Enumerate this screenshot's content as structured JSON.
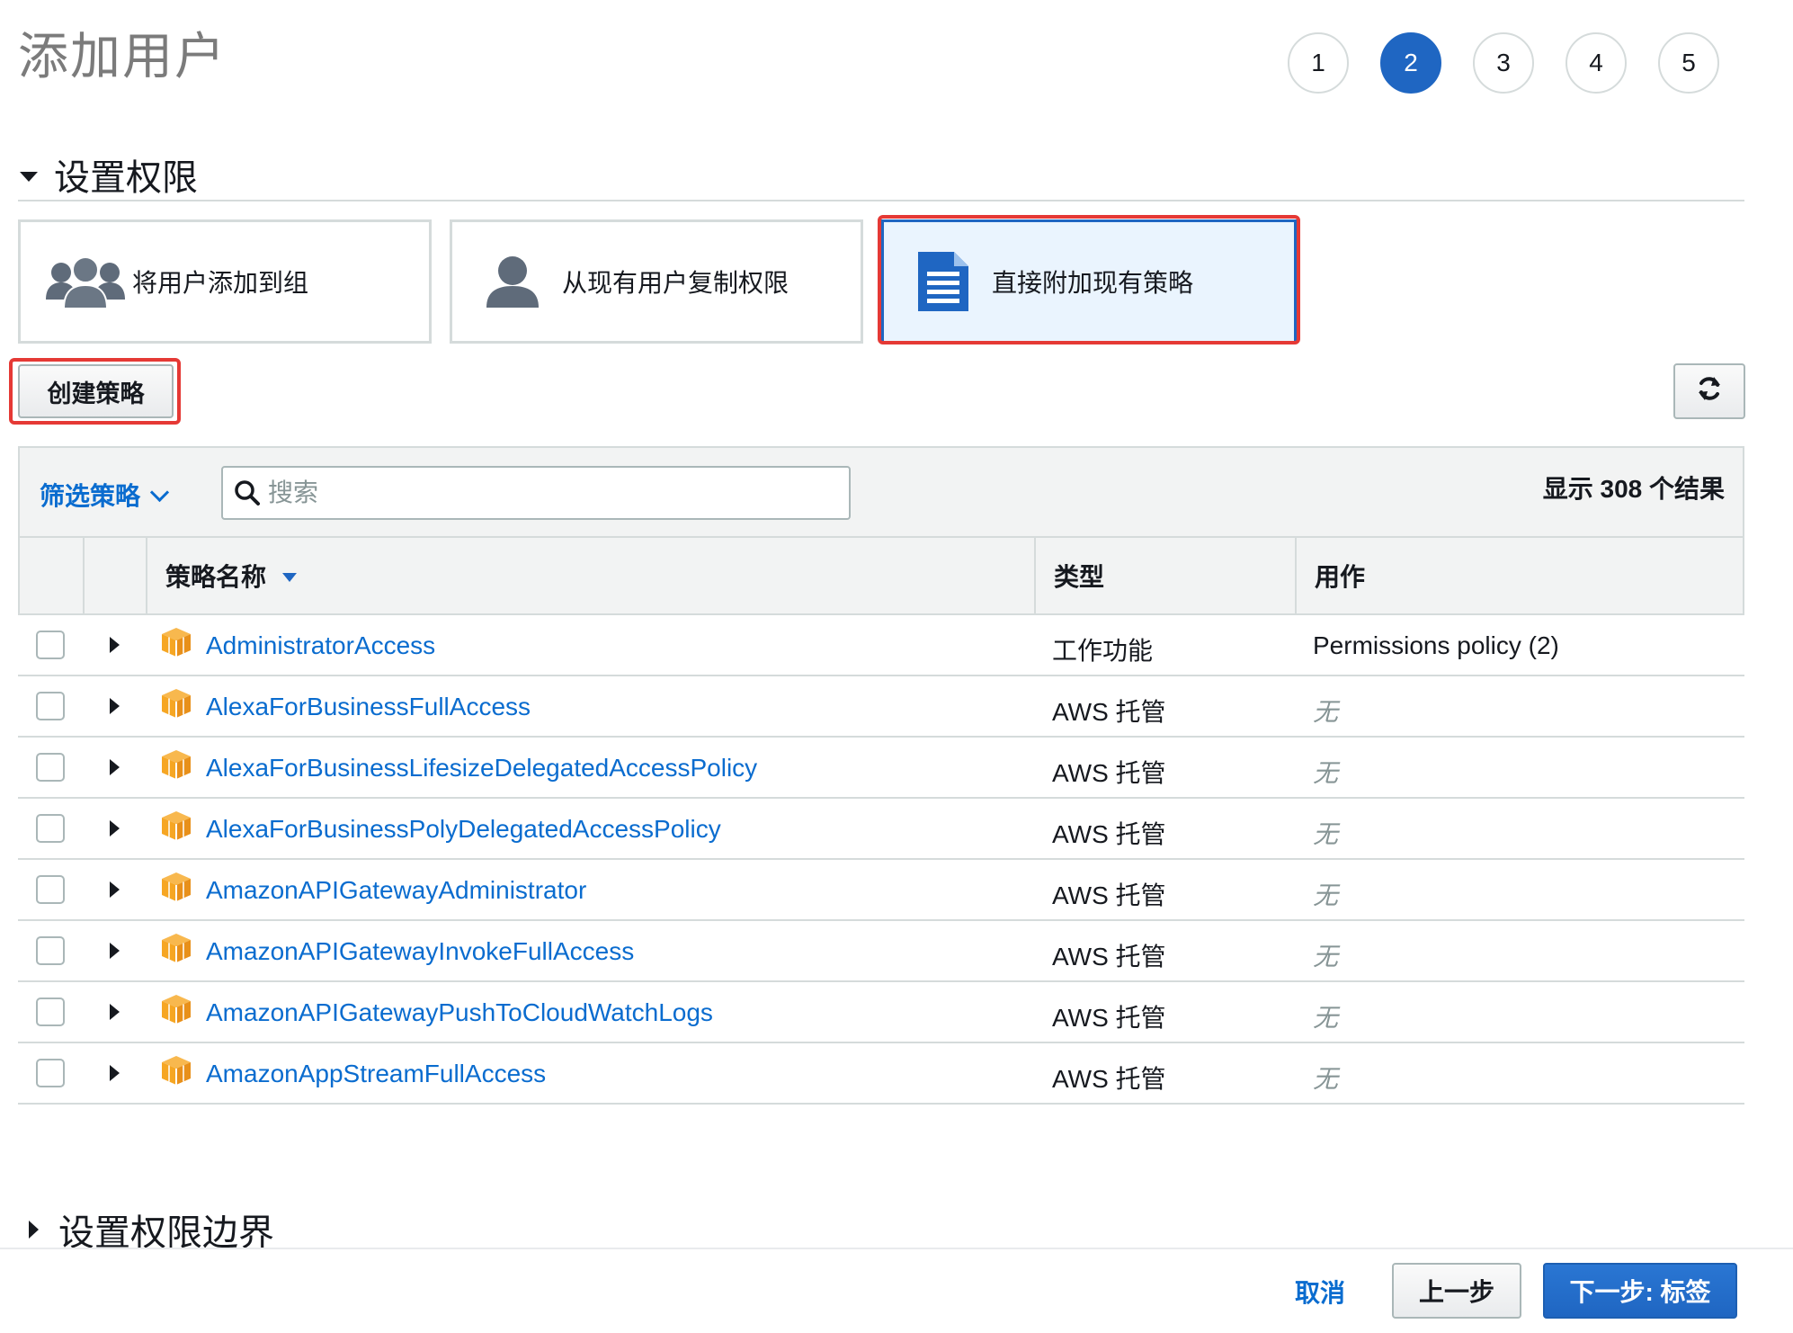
{
  "page": {
    "title": "添加用户"
  },
  "steps": [
    "1",
    "2",
    "3",
    "4",
    "5"
  ],
  "current_step": "2",
  "permissions": {
    "section_title": "设置权限",
    "options": [
      {
        "label": "将用户添加到组",
        "icon": "group-icon",
        "selected": false
      },
      {
        "label": "从现有用户复制权限",
        "icon": "user-icon",
        "selected": false
      },
      {
        "label": "直接附加现有策略",
        "icon": "document-icon",
        "selected": true
      }
    ]
  },
  "toolbar": {
    "create_policy_label": "创建策略",
    "refresh_icon": "refresh-icon",
    "filter_label": "筛选策略",
    "search_placeholder": "搜索",
    "result_count": "显示 308 个结果"
  },
  "table": {
    "columns": {
      "name": "策略名称",
      "type": "类型",
      "usage": "用作"
    },
    "rows": [
      {
        "name": "AdministratorAccess",
        "type": "工作功能",
        "usage": "Permissions policy (2)",
        "usage_none": false
      },
      {
        "name": "AlexaForBusinessFullAccess",
        "type": "AWS 托管",
        "usage": "无",
        "usage_none": true
      },
      {
        "name": "AlexaForBusinessLifesizeDelegatedAccessPolicy",
        "type": "AWS 托管",
        "usage": "无",
        "usage_none": true
      },
      {
        "name": "AlexaForBusinessPolyDelegatedAccessPolicy",
        "type": "AWS 托管",
        "usage": "无",
        "usage_none": true
      },
      {
        "name": "AmazonAPIGatewayAdministrator",
        "type": "AWS 托管",
        "usage": "无",
        "usage_none": true
      },
      {
        "name": "AmazonAPIGatewayInvokeFullAccess",
        "type": "AWS 托管",
        "usage": "无",
        "usage_none": true
      },
      {
        "name": "AmazonAPIGatewayPushToCloudWatchLogs",
        "type": "AWS 托管",
        "usage": "无",
        "usage_none": true
      },
      {
        "name": "AmazonAppStreamFullAccess",
        "type": "AWS 托管",
        "usage": "无",
        "usage_none": true
      }
    ]
  },
  "boundary": {
    "section_title": "设置权限边界"
  },
  "footer": {
    "cancel_label": "取消",
    "previous_label": "上一步",
    "next_label": "下一步: 标签"
  },
  "colors": {
    "accent": "#1f66c2",
    "link": "#0a6ccf",
    "highlight": "#e53935",
    "policy_icon": "#f6a623"
  }
}
